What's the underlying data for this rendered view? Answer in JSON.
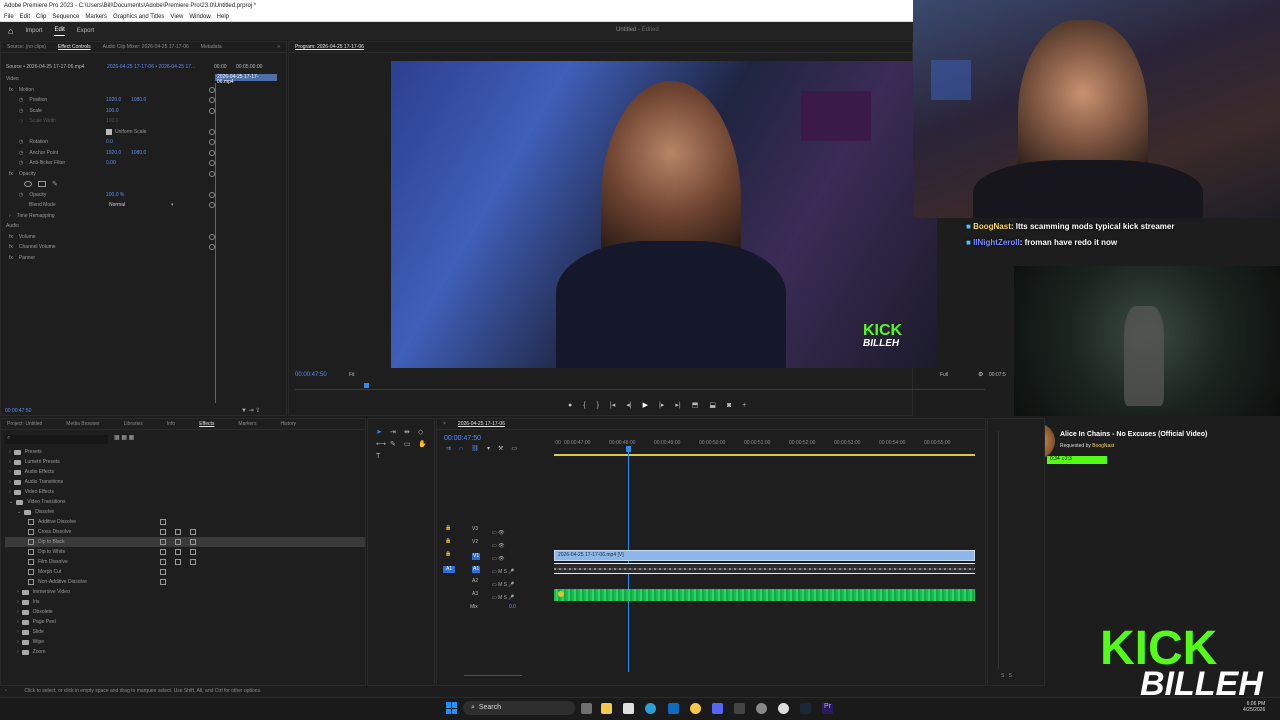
{
  "window": {
    "title": "Adobe Premiere Pro 2023 - C:\\Users\\Bill\\Documents\\Adobe\\Premiere Pro\\23.0\\Untitled.prproj *",
    "menus": [
      "File",
      "Edit",
      "Clip",
      "Sequence",
      "Markers",
      "Graphics and Titles",
      "View",
      "Window",
      "Help"
    ]
  },
  "appbar": {
    "import": "Import",
    "edit": "Edit",
    "export": "Export",
    "doc_title": "Untitled",
    "doc_state": "- Edited"
  },
  "source_panel": {
    "tabs": [
      "Source: (no clips)",
      "Effect Controls",
      "Audio Clip Mixer: 2026-04-25 17-17-06",
      "Metadata"
    ],
    "header_left": "Source • 2026-04-25 17-17-06.mp4",
    "header_right": "2026-04-25 17-17-06 • 2026-04-25 17...",
    "mini_time_left": "00:00",
    "mini_time_right": "00:05:00:00",
    "clip_label": "2026-04-25 17-17-06.mp4",
    "timecode": "00:00:47:50"
  },
  "effect_controls": {
    "video": "Video",
    "motion": "Motion",
    "position": {
      "label": "Position",
      "x": "1920.0",
      "y": "1080.0"
    },
    "scale": {
      "label": "Scale",
      "value": "100.0"
    },
    "scale_width": {
      "label": "Scale Width",
      "value": "100.0"
    },
    "uniform": "Uniform Scale",
    "rotation": {
      "label": "Rotation",
      "value": "0.0"
    },
    "anchor": {
      "label": "Anchor Point",
      "x": "1920.0",
      "y": "1080.0"
    },
    "antiflicker": {
      "label": "Anti-flicker Filter",
      "value": "0.00"
    },
    "opacity": "Opacity",
    "opacity_val": {
      "label": "Opacity",
      "value": "100.0 %"
    },
    "blend": {
      "label": "Blend Mode",
      "value": "Normal"
    },
    "remap": "Time Remapping",
    "audio": "Audio",
    "volume": "Volume",
    "channel": "Channel Volume",
    "panner": "Panner"
  },
  "program_panel": {
    "tab": "Program: 2026-04-25 17-17-06",
    "timecode": "00:00:47:50",
    "fit": "Fit",
    "quality": "Full",
    "end_time": "00:07:5"
  },
  "project_panel": {
    "tabs": [
      "Project: Untitled",
      "Media Browser",
      "Libraries",
      "Info",
      "Effects",
      "Markers",
      "History"
    ],
    "tree": [
      {
        "label": "Presets",
        "indent": 0,
        "type": "folder"
      },
      {
        "label": "Lumetri Presets",
        "indent": 0,
        "type": "folder"
      },
      {
        "label": "Audio Effects",
        "indent": 0,
        "type": "folder"
      },
      {
        "label": "Audio Transitions",
        "indent": 0,
        "type": "folder"
      },
      {
        "label": "Video Effects",
        "indent": 0,
        "type": "folder"
      },
      {
        "label": "Video Transitions",
        "indent": 0,
        "type": "folder"
      },
      {
        "label": "Dissolve",
        "indent": 1,
        "type": "folder"
      },
      {
        "label": "Additive Dissolve",
        "indent": 2,
        "type": "fx"
      },
      {
        "label": "Cross Dissolve",
        "indent": 2,
        "type": "fx"
      },
      {
        "label": "Dip to Black",
        "indent": 2,
        "type": "fx"
      },
      {
        "label": "Dip to White",
        "indent": 2,
        "type": "fx"
      },
      {
        "label": "Film Dissolve",
        "indent": 2,
        "type": "fx"
      },
      {
        "label": "Morph Cut",
        "indent": 2,
        "type": "fx"
      },
      {
        "label": "Non-Additive Dissolve",
        "indent": 2,
        "type": "fx"
      },
      {
        "label": "Immersive Video",
        "indent": 1,
        "type": "folder"
      },
      {
        "label": "Iris",
        "indent": 1,
        "type": "folder"
      },
      {
        "label": "Obsolete",
        "indent": 1,
        "type": "folder"
      },
      {
        "label": "Page Peel",
        "indent": 1,
        "type": "folder"
      },
      {
        "label": "Slide",
        "indent": 1,
        "type": "folder"
      },
      {
        "label": "Wipe",
        "indent": 1,
        "type": "folder"
      },
      {
        "label": "Zoom",
        "indent": 1,
        "type": "folder"
      }
    ]
  },
  "timeline": {
    "tab": "2026-04-25 17-17-06",
    "timecode": "00:00:47:50",
    "ruler": [
      ":00",
      "00:00:47:00",
      "00:00:48:00",
      "00:00:49:00",
      "00:00:50:00",
      "00:00:51:00",
      "00:00:52:00",
      "00:00:53:00",
      "00:00:54:00",
      "00:00:55:00"
    ],
    "tracks": [
      "V3",
      "V2",
      "V1",
      "A1",
      "A2",
      "A3",
      "Mix"
    ],
    "mix_value": "0.0",
    "clip_name": "2026-04-25 17-17-06.mp4 [V]"
  },
  "status": "Click to select, or click in empty space and drag to marquee select. Use Shift, Alt, and Ctrl for other options.",
  "overlay": {
    "chat": [
      {
        "user": "BoogNast",
        "msg": ": ltts scamming mods typical kick streamer"
      },
      {
        "user": "lINightZerolI",
        "msg": ": froman have redo it now"
      }
    ],
    "song_title": "Alice In Chains - No Excuses (Official Video)",
    "song_requested_prefix": "Requested by",
    "song_requested_by": "BoogNast",
    "song_time": "0:34",
    "song_time_2": "2:3",
    "logo_top": "KICK",
    "logo_bottom": "BILLEH"
  },
  "taskbar": {
    "search": "Search",
    "time": "6:06 PM",
    "date": "4/25/2026"
  },
  "colors": {
    "accent": "#2d8ceb",
    "kick_green": "#53fc18",
    "audio_green": "#1db954"
  }
}
